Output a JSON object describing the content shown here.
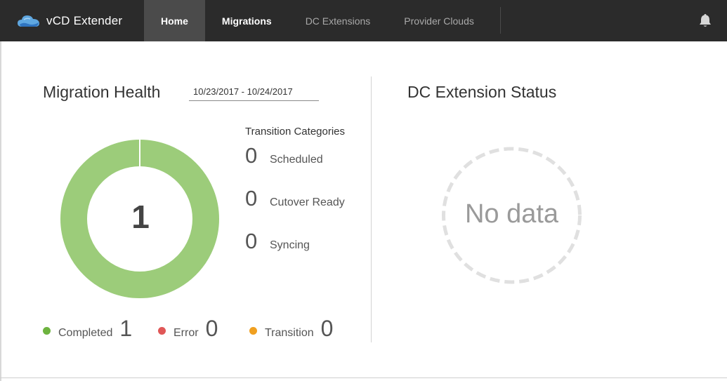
{
  "app": {
    "title": "vCD Extender"
  },
  "nav": {
    "tabs": [
      {
        "label": "Home"
      },
      {
        "label": "Migrations"
      },
      {
        "label": "DC Extensions"
      },
      {
        "label": "Provider Clouds"
      }
    ]
  },
  "icons": {
    "logo": "cloud-logo-icon",
    "notifications": "bell-icon"
  },
  "migration_health": {
    "title": "Migration Health",
    "date_range": "10/23/2017 - 10/24/2017",
    "total": "1",
    "transition_categories": {
      "title": "Transition Categories",
      "items": [
        {
          "count": "0",
          "label": "Scheduled"
        },
        {
          "count": "0",
          "label": "Cutover Ready"
        },
        {
          "count": "0",
          "label": "Syncing"
        }
      ]
    },
    "legend": [
      {
        "label": "Completed",
        "count": "1",
        "color": "#6db33f"
      },
      {
        "label": "Error",
        "count": "0",
        "color": "#e05757"
      },
      {
        "label": "Transition",
        "count": "0",
        "color": "#f0a020"
      }
    ],
    "donut_color": "#9ccc7a"
  },
  "dc_extension_status": {
    "title": "DC Extension Status",
    "empty_text": "No data"
  }
}
